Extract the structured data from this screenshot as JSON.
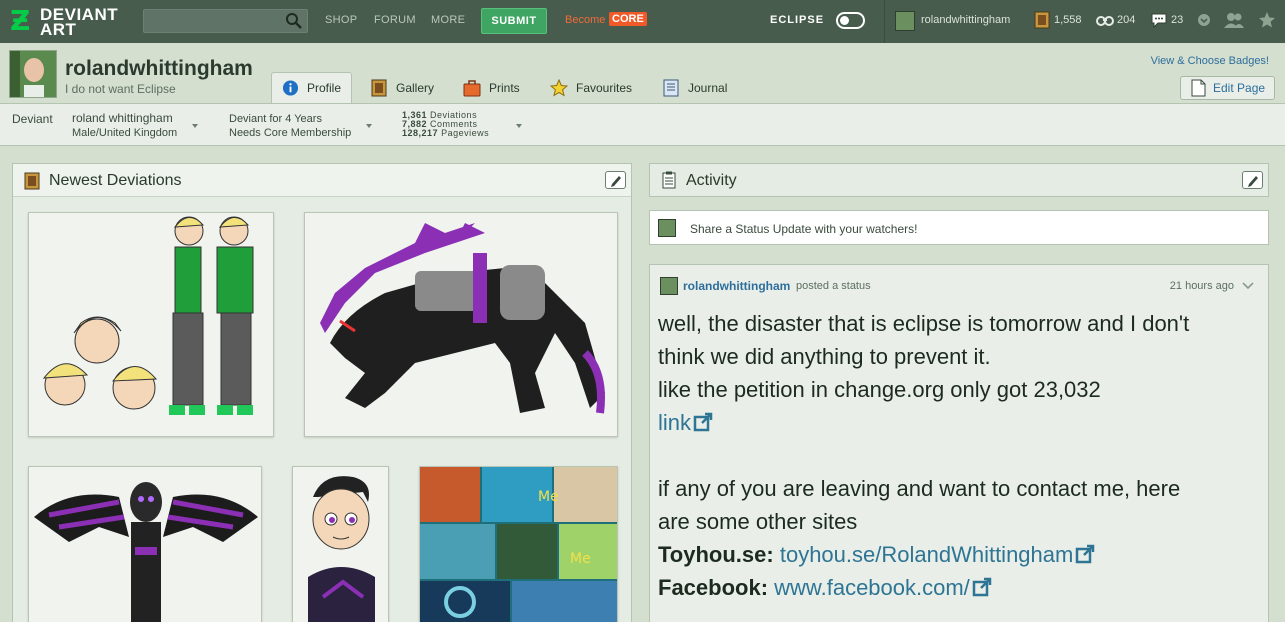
{
  "topbar": {
    "logo_word1": "DEVIANT",
    "logo_word2": "ART",
    "search_placeholder": "",
    "nav": [
      "SHOP",
      "FORUM",
      "MORE"
    ],
    "submit_label": "SUBMIT",
    "become_label": "Become",
    "core_label": "CORE",
    "eclipse_label": "ECLIPSE",
    "username": "rolandwhittingham",
    "stat_deviations": "1,558",
    "stat_watchers": "204",
    "stat_comments": "23",
    "accent_color": "#05cc47"
  },
  "profile": {
    "username": "rolandwhittingham",
    "tagline": "I do not want Eclipse",
    "badges_link": "View & Choose Badges!",
    "edit_label": "Edit Page",
    "tabs": [
      {
        "label": "Profile",
        "icon": "info-icon",
        "active": true
      },
      {
        "label": "Gallery",
        "icon": "gallery-icon",
        "active": false
      },
      {
        "label": "Prints",
        "icon": "prints-icon",
        "active": false
      },
      {
        "label": "Favourites",
        "icon": "star-icon",
        "active": false
      },
      {
        "label": "Journal",
        "icon": "journal-icon",
        "active": false
      }
    ]
  },
  "info": {
    "type": "Deviant",
    "real_name": "roland whittingham",
    "location": "Male/United Kingdom",
    "tenure": "Deviant for 4 Years",
    "membership": "Needs Core Membership",
    "deviations_count": "1,361",
    "deviations_label": "Deviations",
    "comments_count": "7,882",
    "comments_label": "Comments",
    "pageviews_count": "128,217",
    "pageviews_label": "Pageviews"
  },
  "newest": {
    "title": "Newest Deviations"
  },
  "activity": {
    "title": "Activity",
    "share_prompt": "Share a Status Update with your watchers!",
    "post": {
      "user": "rolandwhittingham",
      "action": "posted a status",
      "time": "21 hours ago",
      "lines": [
        "well, the disaster that is eclipse is tomorrow and I don't",
        "think we did anything to prevent it.",
        "like the petition in change.org only got 23,032"
      ],
      "link1": "link",
      "line4": "if any of you are leaving and want to contact me, here",
      "line5": "are some other sites",
      "site1_label": "Toyhou.se:",
      "site1_url": "toyhou.se/RolandWhittingham",
      "site2_label": "Facebook:",
      "site2_url": "www.facebook.com/"
    }
  }
}
